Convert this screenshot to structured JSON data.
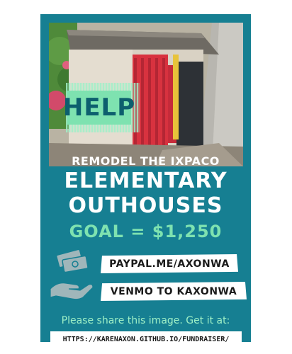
{
  "poster": {
    "help": "HELP",
    "subtitle": "REMODEL THE IXPACO",
    "title_line1": "ELEMENTARY",
    "title_line2": "OUTHOUSES",
    "goal": "GOAL = $1,250",
    "paypal": "PAYPAL.ME/AXONWA",
    "venmo": "VENMO TO KAXONWA",
    "share": "Please share this image. Get it at:",
    "url": "HTTPS://KARENAXON.GITHUB.IO/FUNDRAISER/"
  },
  "icons": {
    "money": "hand-with-money-icon"
  },
  "colors": {
    "background": "#167f92",
    "accent_green": "#7ee2b0",
    "text_white": "#ffffff",
    "door_red": "#d8323f"
  }
}
